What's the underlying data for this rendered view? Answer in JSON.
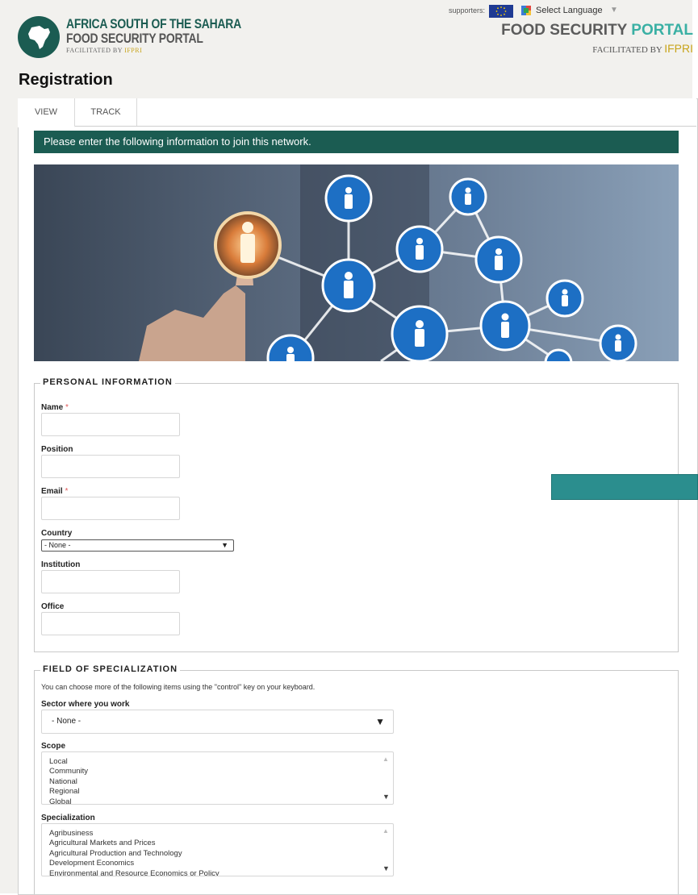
{
  "header": {
    "logo_line1": "AFRICA SOUTH OF THE SAHARA",
    "logo_line2": "FOOD SECURITY PORTAL",
    "logo_line3": "FACILITATED BY",
    "logo_line3_brand": "IFPRI",
    "supporters_label": "supporters:",
    "select_language": "Select Language",
    "lang_caret": "▼",
    "portal_title_main": "FOOD SECURITY",
    "portal_title_accent": "PORTAL",
    "portal_sub": "FACILITATED BY",
    "portal_sub_brand": "IFPRI"
  },
  "page": {
    "title": "Registration"
  },
  "tabs": [
    {
      "label": "VIEW",
      "active": true
    },
    {
      "label": "TRACK",
      "active": false
    }
  ],
  "banner": {
    "text": "Please enter the following information to join this network."
  },
  "personal": {
    "legend": "PERSONAL INFORMATION",
    "name_label": "Name",
    "position_label": "Position",
    "email_label": "Email",
    "required_mark": "*",
    "country_label": "Country",
    "country_value": "- None -",
    "institution_label": "Institution",
    "office_label": "Office"
  },
  "specialization": {
    "legend": "FIELD OF SPECIALIZATION",
    "note": "You can choose more of the following items using the \"control\" key on your keyboard.",
    "sector_label": "Sector where you work",
    "sector_value": "- None -",
    "scope_label": "Scope",
    "scope_options": [
      "Local",
      "Community",
      "National",
      "Regional",
      "Global"
    ],
    "specialization_label": "Specialization",
    "specialization_options": [
      "Agribusiness",
      "Agricultural Markets and Prices",
      "Agricultural Production and Technology",
      "Development Economics",
      "Environmental and Resource Economics or Policy"
    ]
  },
  "colors": {
    "brand_green": "#1b5c52",
    "accent_teal": "#3ab0a4",
    "side_button": "#2b8e8e",
    "ifpri_gold": "#c8a41a",
    "required_red": "#e05a5a"
  }
}
